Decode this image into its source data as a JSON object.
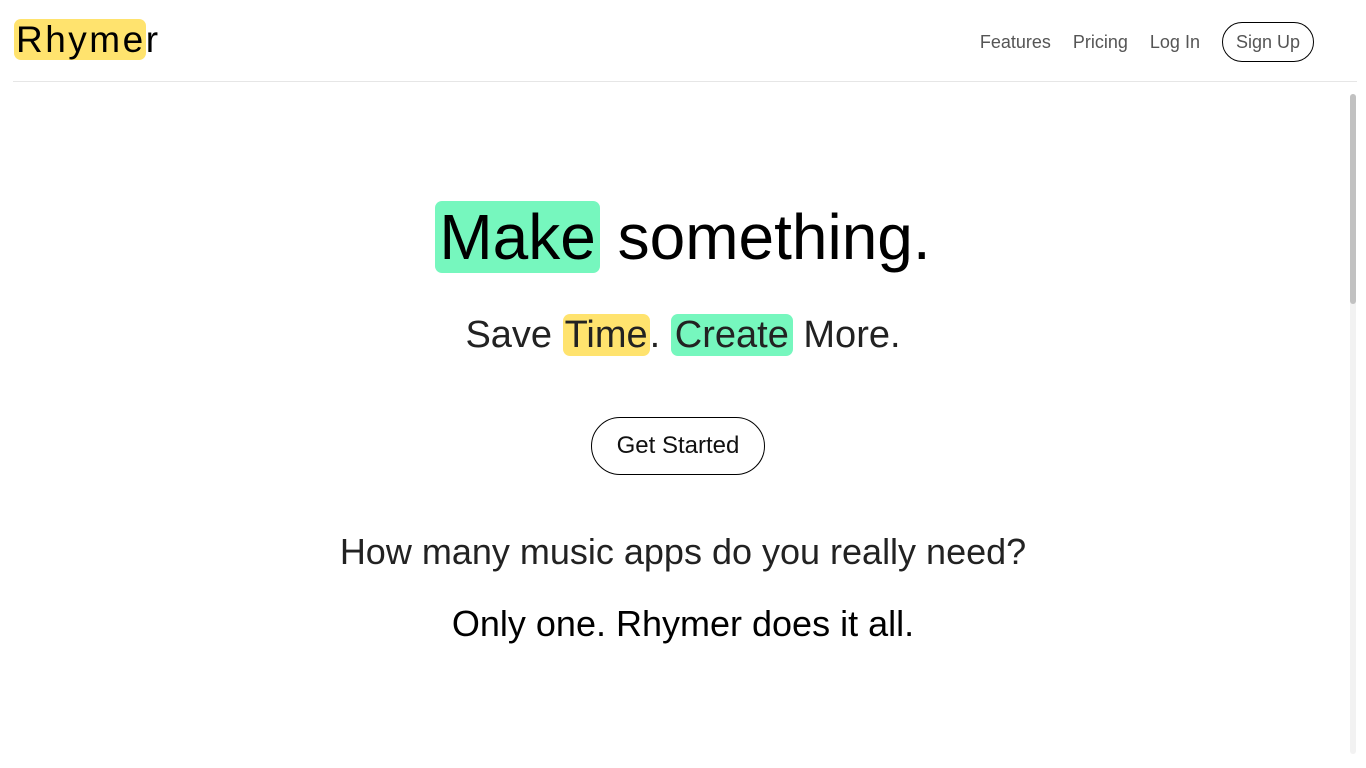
{
  "header": {
    "logo_highlight": "Rhyme",
    "logo_rest": "r",
    "nav": {
      "features": "Features",
      "pricing": "Pricing",
      "login": "Log In",
      "signup": "Sign Up"
    }
  },
  "hero": {
    "title_highlight": "Make",
    "title_rest": " something.",
    "subtitle": {
      "part1": "Save ",
      "hl1": "Time",
      "part2": ". ",
      "hl2": "Create",
      "part3": " More."
    },
    "cta_label": "Get Started"
  },
  "pitch": {
    "question": "How many music apps do you really need?",
    "answer": "Only one. Rhymer does it all."
  },
  "colors": {
    "highlight_yellow": "#ffe36e",
    "highlight_green": "#76f7be"
  }
}
